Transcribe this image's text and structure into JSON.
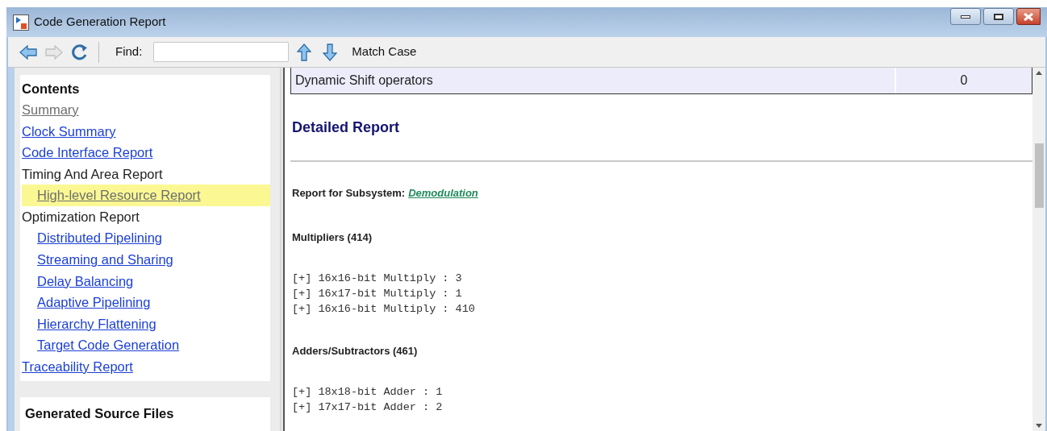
{
  "window": {
    "title": "Code Generation Report"
  },
  "toolbar": {
    "find_label": "Find:",
    "match_case": "Match Case"
  },
  "sidebar": {
    "title": "Contents",
    "items": [
      {
        "label": "Summary",
        "kind": "link",
        "visited": true,
        "selected": false
      },
      {
        "label": "Clock Summary",
        "kind": "link",
        "visited": false,
        "selected": false
      },
      {
        "label": "Code Interface Report",
        "kind": "link",
        "visited": false,
        "selected": false
      },
      {
        "label": "Timing And Area Report",
        "kind": "heading",
        "selected": false,
        "children": [
          {
            "label": "High-level Resource Report",
            "kind": "link",
            "visited": true,
            "selected": true
          }
        ]
      },
      {
        "label": "Optimization Report",
        "kind": "heading",
        "selected": false,
        "children": [
          {
            "label": "Distributed Pipelining",
            "kind": "link",
            "visited": false,
            "selected": false
          },
          {
            "label": "Streaming and Sharing",
            "kind": "link",
            "visited": false,
            "selected": false
          },
          {
            "label": "Delay Balancing",
            "kind": "link",
            "visited": false,
            "selected": false
          },
          {
            "label": "Adaptive Pipelining",
            "kind": "link",
            "visited": false,
            "selected": false
          },
          {
            "label": "Hierarchy Flattening",
            "kind": "link",
            "visited": false,
            "selected": false
          },
          {
            "label": "Target Code Generation",
            "kind": "link",
            "visited": false,
            "selected": false
          }
        ]
      },
      {
        "label": "Traceability Report",
        "kind": "link",
        "visited": false,
        "selected": false
      }
    ],
    "files_title": "Generated Source Files"
  },
  "report": {
    "summary_row": {
      "label": "Dynamic Shift operators",
      "value": "0"
    },
    "heading": "Detailed Report",
    "subsystem_label": "Report for Subsystem:",
    "subsystem_link": "Demodulation",
    "sections": [
      {
        "title": "Multipliers (414)",
        "lines": [
          "[+] 16x16-bit Multiply : 3",
          "[+] 16x17-bit Multiply : 1",
          "[+] 16x16-bit Multiply : 410"
        ]
      },
      {
        "title": "Adders/Subtractors (461)",
        "lines": [
          "[+] 18x18-bit Adder : 1",
          "[+] 17x17-bit Adder : 2"
        ]
      }
    ]
  }
}
